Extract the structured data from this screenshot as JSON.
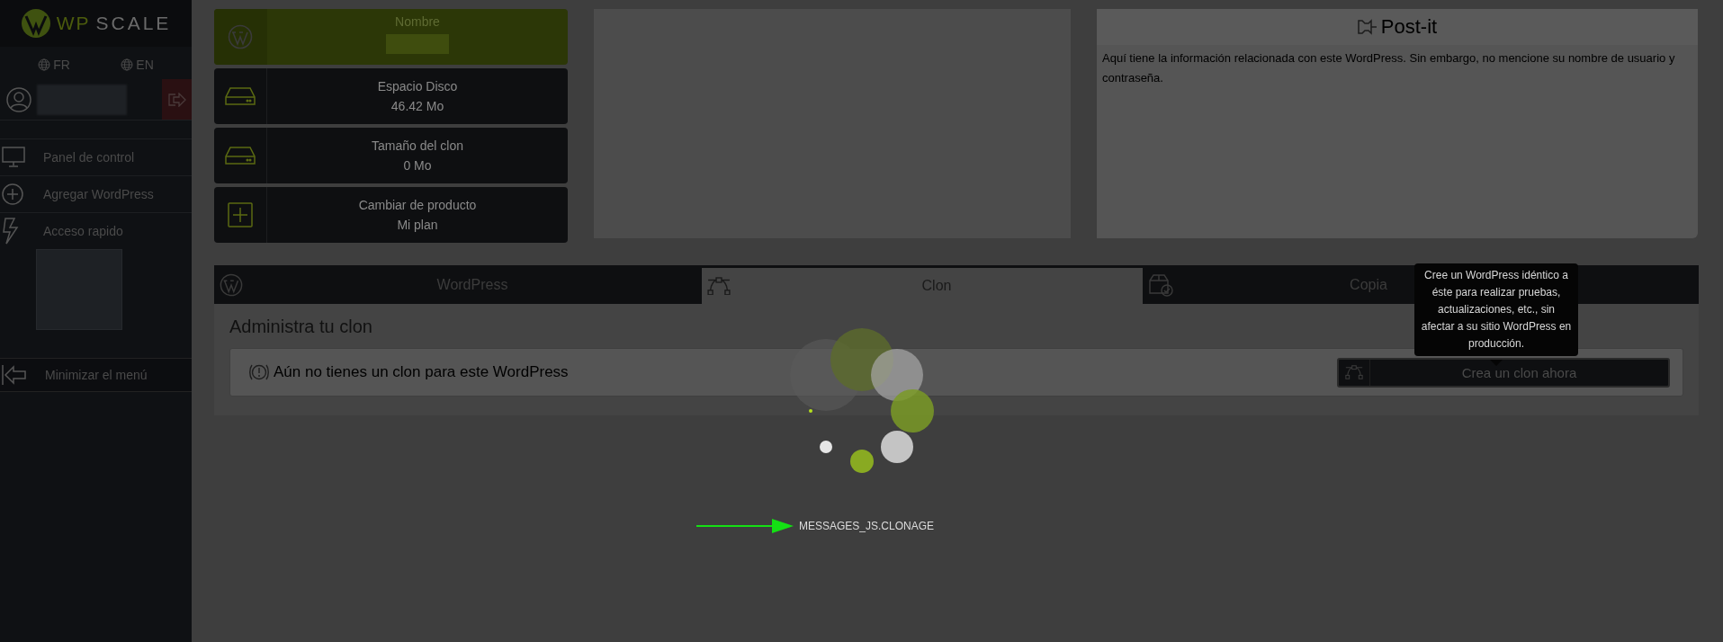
{
  "sidebar": {
    "logo": {
      "text_1": "WP",
      "text_2": "SCALE"
    },
    "languages": [
      {
        "label": "FR"
      },
      {
        "label": "EN"
      }
    ],
    "menu": [
      {
        "label": "Panel de control",
        "kind": "monitor"
      },
      {
        "label": "Agregar WordPress",
        "kind": "plus"
      },
      {
        "label": "Acceso rapido",
        "kind": "bolt"
      }
    ],
    "collapse": "Minimizar el menú"
  },
  "cards": [
    {
      "title": "Nombre",
      "kind": "wordpress",
      "highlighted": true
    },
    {
      "title": "Espacio Disco",
      "value": "46.42 Mo",
      "kind": "disk",
      "highlighted": false
    },
    {
      "title": "Tamaño del clon",
      "value": "0 Mo",
      "kind": "disk",
      "highlighted": false
    },
    {
      "title": "Cambiar de producto",
      "value": "Mi plan",
      "kind": "plus",
      "highlighted": false
    }
  ],
  "postit": {
    "title": "Post-it",
    "text": "Aquí tiene la información relacionada con este WordPress. Sin embargo, no mencione su nombre de usuario y contraseña."
  },
  "tabs": [
    {
      "label": "WordPress",
      "kind": "wordpress",
      "selected": false
    },
    {
      "label": "Clon",
      "kind": "clone",
      "selected": true
    },
    {
      "label": "Copia",
      "kind": "backup",
      "selected": false
    }
  ],
  "panel": {
    "title": "Administra tu clon",
    "notice": "Aún no tienes un clon para este WordPress",
    "button": "Crea un clon ahora",
    "tooltip": "Cree un WordPress idéntico a éste para realizar pruebas, actualizaciones, etc., sin afectar a su sitio WordPress en producción."
  },
  "loading": {
    "message": "MESSAGES_JS.CLONAGE"
  }
}
